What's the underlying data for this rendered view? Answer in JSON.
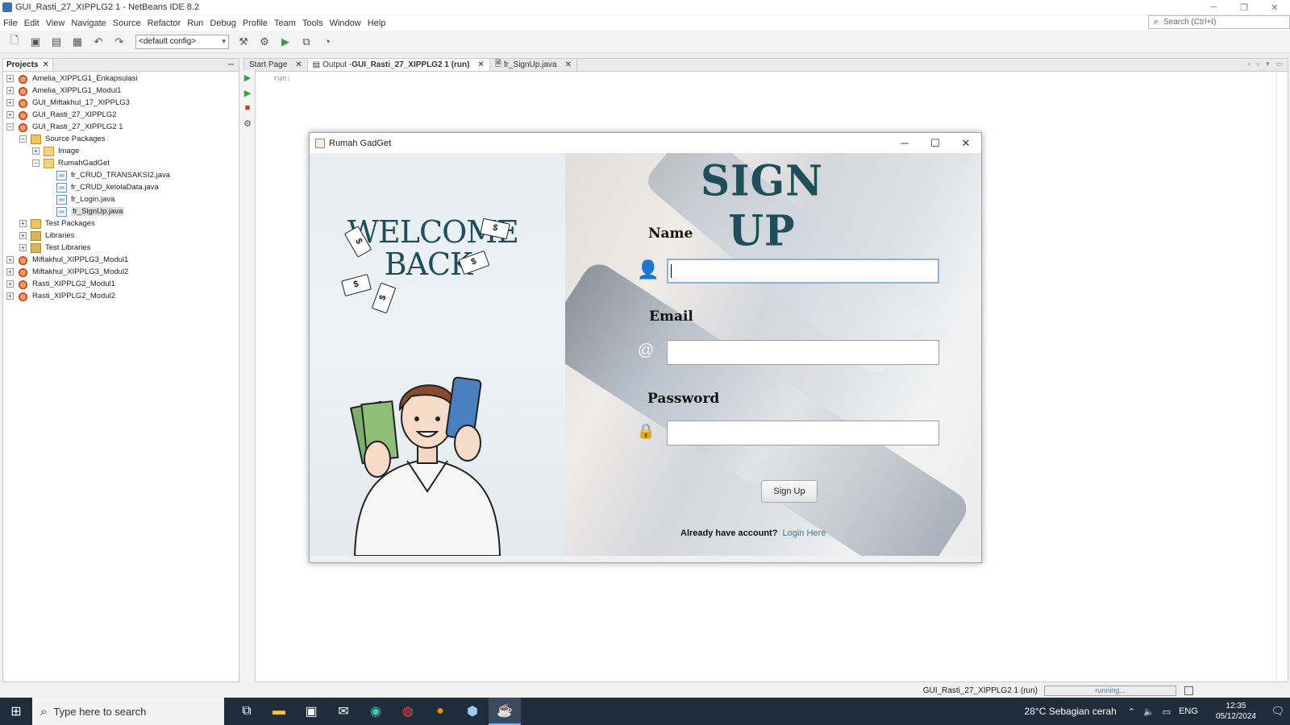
{
  "window": {
    "title": "GUI_Rasti_27_XIPPLG2 1 - NetBeans IDE 8.2",
    "controls": {
      "minimize": "─",
      "restore": "❐",
      "close": "✕"
    }
  },
  "menu": [
    "File",
    "Edit",
    "View",
    "Navigate",
    "Source",
    "Refactor",
    "Run",
    "Debug",
    "Profile",
    "Team",
    "Tools",
    "Window",
    "Help"
  ],
  "search": {
    "placeholder": "Search (Ctrl+I)"
  },
  "toolbar": {
    "config": "<default config>"
  },
  "projects": {
    "tab_label": "Projects",
    "tree": [
      {
        "label": "Amelia_XIPPLG1_Enkapsulasi",
        "icon": "project-icon",
        "expander": "+",
        "depth": 0
      },
      {
        "label": "Amelia_XIPPLG1_Modul1",
        "icon": "project-icon",
        "expander": "+",
        "depth": 0
      },
      {
        "label": "GUI_Miftakhul_17_XIPPLG3",
        "icon": "project-icon",
        "expander": "+",
        "depth": 0
      },
      {
        "label": "GUI_Rasti_27_XIPPLG2",
        "icon": "project-icon",
        "expander": "+",
        "depth": 0
      },
      {
        "label": "GUI_Rasti_27_XIPPLG2 1",
        "icon": "project-icon",
        "expander": "−",
        "depth": 0
      },
      {
        "label": "Source Packages",
        "icon": "folder-icon",
        "expander": "−",
        "depth": 1
      },
      {
        "label": "Image",
        "icon": "package-icon",
        "expander": "+",
        "depth": 2
      },
      {
        "label": "RumahGadGet",
        "icon": "package-icon",
        "expander": "−",
        "depth": 2
      },
      {
        "label": "fr_CRUD_TRANSAKSI2.java",
        "icon": "java-file-icon",
        "expander": "",
        "depth": 3
      },
      {
        "label": "fr_CRUD_kelolaData.java",
        "icon": "java-file-icon",
        "expander": "",
        "depth": 3
      },
      {
        "label": "fr_Login.java",
        "icon": "java-file-icon",
        "expander": "",
        "depth": 3
      },
      {
        "label": "fr_SignUp.java",
        "icon": "java-file-icon",
        "expander": "",
        "depth": 3,
        "selected": true
      },
      {
        "label": "Test Packages",
        "icon": "folder-icon",
        "expander": "+",
        "depth": 1
      },
      {
        "label": "Libraries",
        "icon": "library-icon",
        "expander": "+",
        "depth": 1
      },
      {
        "label": "Test Libraries",
        "icon": "library-icon",
        "expander": "+",
        "depth": 1
      },
      {
        "label": "Miftakhul_XIPPLG3_Modul1",
        "icon": "project-icon",
        "expander": "+",
        "depth": 0
      },
      {
        "label": "Miftakhul_XIPPLG3_Modul2",
        "icon": "project-icon",
        "expander": "+",
        "depth": 0
      },
      {
        "label": "Rasti_XIPPLG2_Modul1",
        "icon": "project-icon",
        "expander": "+",
        "depth": 0
      },
      {
        "label": "Rasti_XIPPLG2_Modul2",
        "icon": "project-icon",
        "expander": "+",
        "depth": 0
      }
    ]
  },
  "editor": {
    "tabs": [
      {
        "label": "Start Page",
        "active": false
      },
      {
        "label_prefix": "Output - ",
        "label_bold": "GUI_Rasti_27_XIPPLG2 1 (run)",
        "active": true
      },
      {
        "label": "fr_SignUp.java",
        "active": false
      }
    ],
    "output_text": "run:"
  },
  "status": {
    "project": "GUI_Rasti_27_XIPPLG2 1 (run)",
    "progress_text": "running..."
  },
  "dialog": {
    "title": "Rumah GadGet",
    "heading": "SIGN UP",
    "welcome_line1": "WELCOME",
    "welcome_line2": "BACK",
    "name_label": "Name",
    "email_label": "Email",
    "password_label": "Password",
    "email_icon": "@",
    "button": "Sign Up",
    "already_text": "Already have account?",
    "login_link": "Login Here"
  },
  "taskbar": {
    "search_placeholder": "Type here to search",
    "weather": "28°C  Sebagian cerah",
    "lang": "ENG",
    "time": "12:35",
    "date": "05/12/2024"
  }
}
